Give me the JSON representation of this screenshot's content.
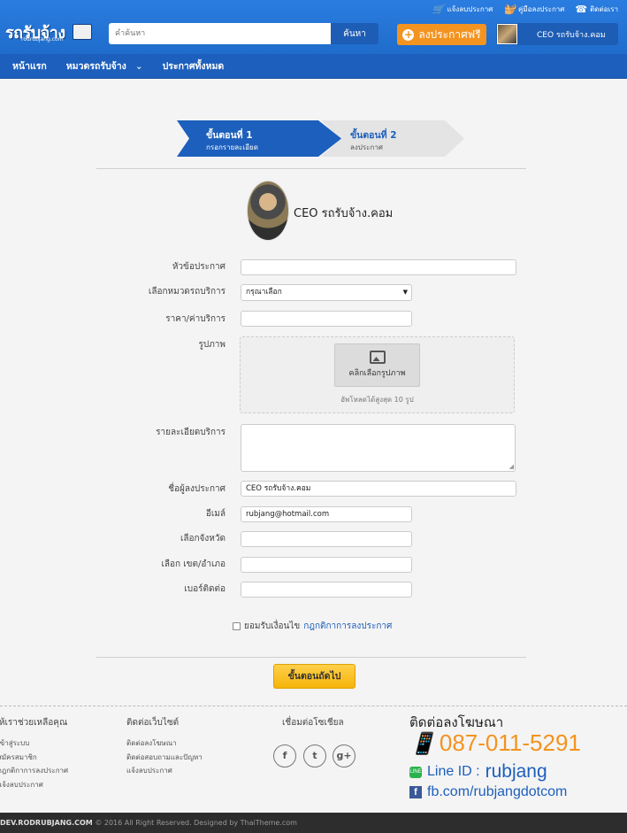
{
  "header": {
    "logo": "รถรับจ้าง",
    "logo_sub": "rodrubjang.com",
    "top_links": [
      {
        "label": "แจ้งลบประกาศ",
        "icon": "cart-icon"
      },
      {
        "label": "คู่มือลงประกาศ",
        "icon": "basket-icon"
      },
      {
        "label": "ติดต่อเรา",
        "icon": "phone-icon"
      }
    ],
    "search_placeholder": "คำค้นหา",
    "search_button": "ค้นหา",
    "post_button": "ลงประกาศฟรี",
    "user_name": "CEO รถรับจ้าง.คอม"
  },
  "nav": {
    "items": [
      "หน้าแรก",
      "หมวดรถรับจ้าง",
      "ประกาศทั้งหมด"
    ],
    "dropdown_chevron": "⌄"
  },
  "steps": [
    {
      "title": "ขั้นตอนที่ 1",
      "subtitle": "กรอกรายละเอียด",
      "active": true
    },
    {
      "title": "ขั้นตอนที่ 2",
      "subtitle": "ลงประกาศ",
      "active": false
    }
  ],
  "profile": {
    "name": "CEO รถรับจ้าง.คอม"
  },
  "form": {
    "title_label": "หัวข้อประกาศ",
    "title_value": "",
    "category_label": "เลือกหมวดรถบริการ",
    "category_value": "กรุณาเลือก",
    "price_label": "ราคา/ค่าบริการ",
    "price_value": "",
    "image_label": "รูปภาพ",
    "upload_button": "คลิกเลือกรูปภาพ",
    "upload_note": "อัพโหลดได้สูงสุด 10 รูป",
    "detail_label": "รายละเอียดบริการ",
    "poster_label": "ชื่อผู้ลงประกาศ",
    "poster_value": "CEO รถรับจ้าง.คอม",
    "email_label": "อีเมล์",
    "email_value": "rubjang@hotmail.com",
    "province_label": "เลือกจังหวัด",
    "province_value": "",
    "district_label": "เลือก เขต/อำเภอ",
    "district_value": "",
    "phone_label": "เบอร์ติดต่อ",
    "phone_value": "",
    "agree_text": "ยอมรับเงื่อนไข",
    "agree_link": "กฎกติกาการลงประกาศ",
    "agree_checked": false,
    "next_button": "ขั้นตอนถัดไป"
  },
  "footer": {
    "help": {
      "heading": "ให้เราช่วยเหลือคุณ",
      "links": [
        "เข้าสู่ระบบ",
        "สมัครสมาชิก",
        "กฎกติกาการลงประกาศ",
        "แจ้งลบประกาศ"
      ]
    },
    "contact_site": {
      "heading": "ติดต่อเว็บไซต์",
      "links": [
        "ติดต่อลงโฆษณา",
        "ติดต่อสอบถามและปัญหา",
        "แจ้งลบประกาศ"
      ]
    },
    "social": {
      "heading": "เชื่อมต่อโซเชียล",
      "icons": [
        "facebook-icon",
        "twitter-icon",
        "google-plus-icon"
      ]
    },
    "advertise": {
      "heading": "ติดต่อลงโฆษณา",
      "phone": "087-011-5291",
      "line_prefix": "Line ID :",
      "line_id": "rubjang",
      "facebook": "fb.com/rubjangdotcom"
    },
    "copyright_site": "DEV.RODRUBJANG.COM",
    "copyright_text": "© 2016 All Right Reserved. Designed by ThaiTheme.com"
  },
  "colors": {
    "primary": "#1d5fbc",
    "accent": "#f39320",
    "button_yellow": "#f5b40a"
  }
}
